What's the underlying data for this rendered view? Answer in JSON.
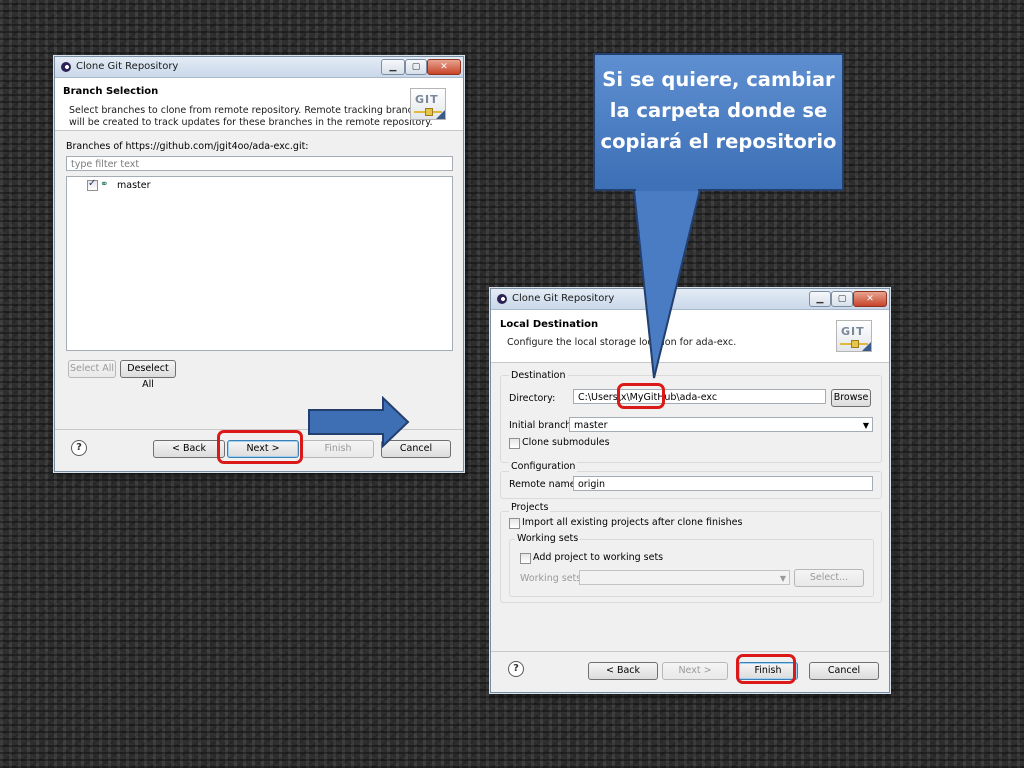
{
  "colors": {
    "background": "#333333",
    "highlight_ring": "#dc1919",
    "callout_fill": "#4a7cc4",
    "arrow_fill": "#3e6fb4"
  },
  "window1": {
    "title": "Clone Git Repository",
    "header_title": "Branch Selection",
    "header_desc_line1": "Select branches to clone from remote repository. Remote tracking branches",
    "header_desc_line2": "will be created to track updates for these branches in the remote repository.",
    "branches_label": "Branches of https://github.com/jgit4oo/ada-exc.git:",
    "filter_placeholder": "type filter text",
    "branches": [
      {
        "name": "master",
        "checked": true
      }
    ],
    "select_all": "Select All",
    "deselect_all": "Deselect All",
    "back": "< Back",
    "next": "Next >",
    "finish": "Finish",
    "cancel": "Cancel",
    "help_icon": "help-icon",
    "branch_icon": "branch-icon"
  },
  "window2": {
    "title": "Clone Git Repository",
    "header_title": "Local Destination",
    "header_desc": "Configure the local storage location for ada-exc.",
    "destination_group": "Destination",
    "directory_label": "Directory:",
    "directory_value": "C:\\Users\\x\\MyGitHub\\ada-exc",
    "browse": "Browse",
    "initial_branch_label": "Initial branch:",
    "initial_branch_value": "master",
    "clone_submodules": "Clone submodules",
    "configuration_group": "Configuration",
    "remote_name_label": "Remote name:",
    "remote_name_value": "origin",
    "projects_group": "Projects",
    "import_projects": "Import all existing projects after clone finishes",
    "working_sets_group": "Working sets",
    "add_to_working_sets": "Add project to working sets",
    "working_sets_label": "Working sets:",
    "select_button": "Select...",
    "back": "< Back",
    "next": "Next >",
    "finish": "Finish",
    "cancel": "Cancel"
  },
  "callout": {
    "line1": "Si se quiere, cambiar",
    "line2": "la carpeta donde se",
    "line3": "copiará el repositorio"
  }
}
